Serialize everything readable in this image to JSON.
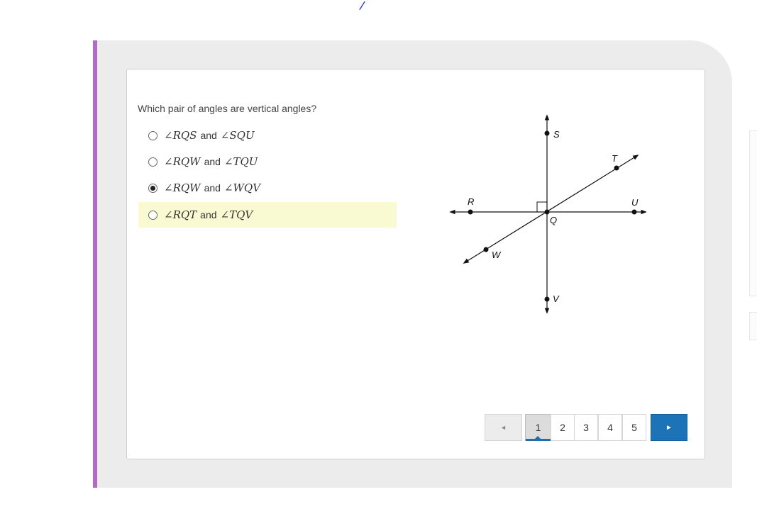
{
  "question": "Which pair of angles are vertical angles?",
  "choices": [
    {
      "a": "∠RQS",
      "conj": "and",
      "b": "∠SQU",
      "selected": false,
      "highlighted": false
    },
    {
      "a": "∠RQW",
      "conj": "and",
      "b": "∠TQU",
      "selected": false,
      "highlighted": false
    },
    {
      "a": "∠RQW",
      "conj": "and",
      "b": "∠WQV",
      "selected": true,
      "highlighted": false
    },
    {
      "a": "∠RQT",
      "conj": "and",
      "b": "∠TQV",
      "selected": false,
      "highlighted": true
    }
  ],
  "diagram": {
    "labels": {
      "S": "S",
      "T": "T",
      "R": "R",
      "U": "U",
      "Q": "Q",
      "W": "W",
      "V": "V"
    }
  },
  "pagination": {
    "prev": "◄",
    "pages": [
      "1",
      "2",
      "3",
      "4",
      "5"
    ],
    "current": "1",
    "next": "►"
  },
  "colors": {
    "accent_bar": "#b36bc9",
    "next_button": "#1c73b5",
    "highlight": "#fafad2"
  }
}
